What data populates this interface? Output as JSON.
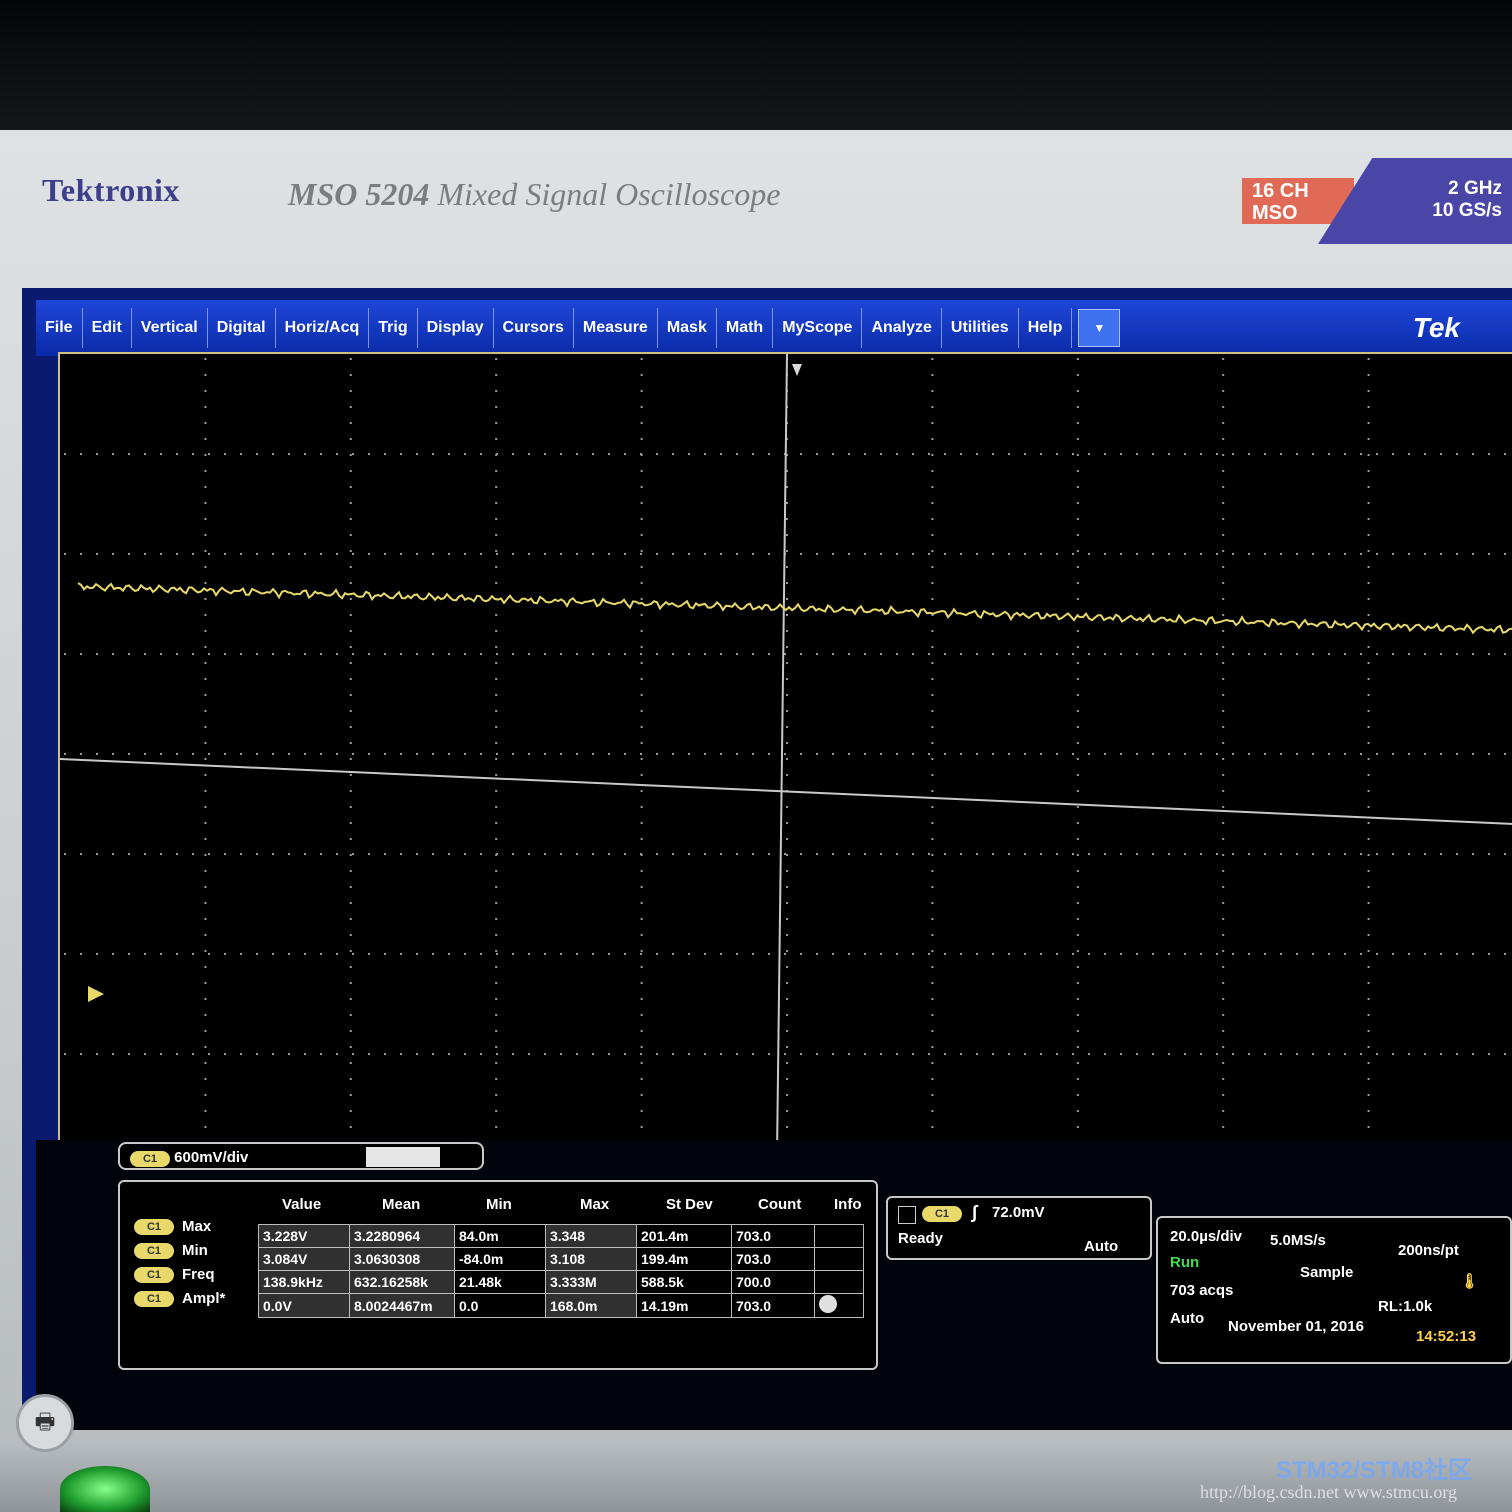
{
  "header": {
    "brand": "Tektronix",
    "model_number": "MSO 5204",
    "model_desc": "Mixed Signal Oscilloscope",
    "badge_channels_line1": "16 CH",
    "badge_channels_line2": "MSO",
    "badge_spec_line1": "2 GHz",
    "badge_spec_line2": "10 GS/s"
  },
  "menu": {
    "items": [
      "File",
      "Edit",
      "Vertical",
      "Digital",
      "Horiz/Acq",
      "Trig",
      "Display",
      "Cursors",
      "Measure",
      "Mask",
      "Math",
      "MyScope",
      "Analyze",
      "Utilities",
      "Help"
    ],
    "dropdown_glyph": "▼",
    "logo": "Tek"
  },
  "channel": {
    "label": "C1",
    "scale": "600mV/div"
  },
  "measurements": {
    "headers": [
      "Value",
      "Mean",
      "Min",
      "Max",
      "St Dev",
      "Count",
      "Info"
    ],
    "rows": [
      {
        "label": "Max",
        "channel": "C1",
        "values": [
          "3.228V",
          "3.2280964",
          "84.0m",
          "3.348",
          "201.4m",
          "703.0"
        ]
      },
      {
        "label": "Min",
        "channel": "C1",
        "values": [
          "3.084V",
          "3.0630308",
          "-84.0m",
          "3.108",
          "199.4m",
          "703.0"
        ]
      },
      {
        "label": "Freq",
        "channel": "C1",
        "values": [
          "138.9kHz",
          "632.16258k",
          "21.48k",
          "3.333M",
          "588.5k",
          "700.0"
        ]
      },
      {
        "label": "Ampl*",
        "channel": "C1",
        "values": [
          "0.0V",
          "8.0024467m",
          "0.0",
          "168.0m",
          "14.19m",
          "703.0"
        ]
      }
    ]
  },
  "trigger": {
    "channel": "C1",
    "level": "72.0mV",
    "state": "Ready",
    "mode": "Auto"
  },
  "acquisition": {
    "timebase": "20.0µs/div",
    "sample_rate": "5.0MS/s",
    "resolution": "200ns/pt",
    "run_state": "Run",
    "mode": "Sample",
    "acqs": "703 acqs",
    "record_length": "RL:1.0k",
    "trigger_mode": "Auto",
    "date": "November 01, 2016",
    "time": "14:52:13"
  },
  "watermark": {
    "line1": "STM32/STM8社区",
    "line2": "http://blog.csdn.net www.stmcu.org"
  },
  "colors": {
    "trace": "#e8d96a",
    "menubar": "#1a3ed0",
    "run": "#3ddc52",
    "time": "#ffd24a"
  },
  "icons": {
    "printer": "printer-icon",
    "power": "power-icon",
    "trigger_slope": "rising-edge-icon"
  }
}
